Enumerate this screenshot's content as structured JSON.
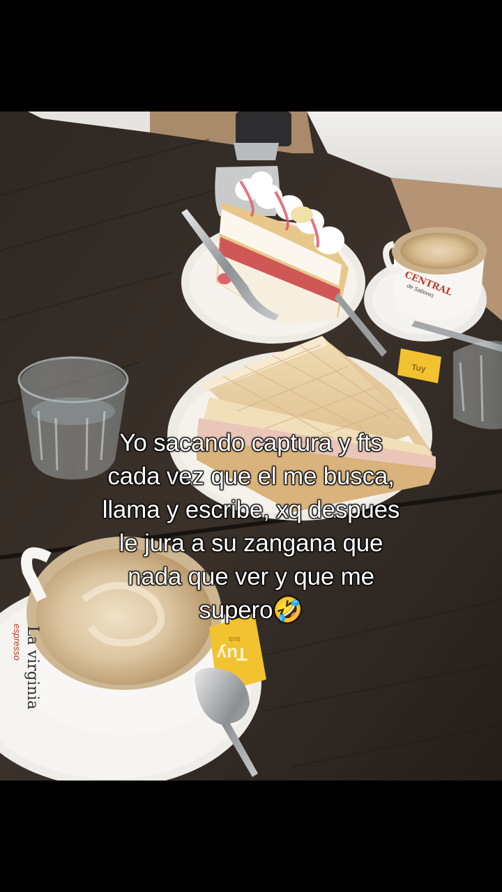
{
  "caption": {
    "lines": [
      "Yo sacando captura y fts",
      "cada vez que el me busca,",
      "llama y escribe, xq despues",
      "le jura a su zangana que",
      "nada que ver y que me",
      "supero🤣"
    ]
  },
  "photo": {
    "cup_back_brand": "CENTRAL",
    "cup_back_subbrand": "de Sabores",
    "cup_front_brand": "La virginia",
    "cup_front_subbrand": "espresso",
    "sugar_packet_label": "Tuy",
    "sugar_packet_sub": "sus"
  },
  "colors": {
    "table": "#2b2520",
    "plate": "#efece6",
    "cream": "#f6f2ea",
    "strawberry": "#d6404e",
    "packet": "#f2c230",
    "text_fill": "#ffffff",
    "text_stroke": "#000000"
  }
}
